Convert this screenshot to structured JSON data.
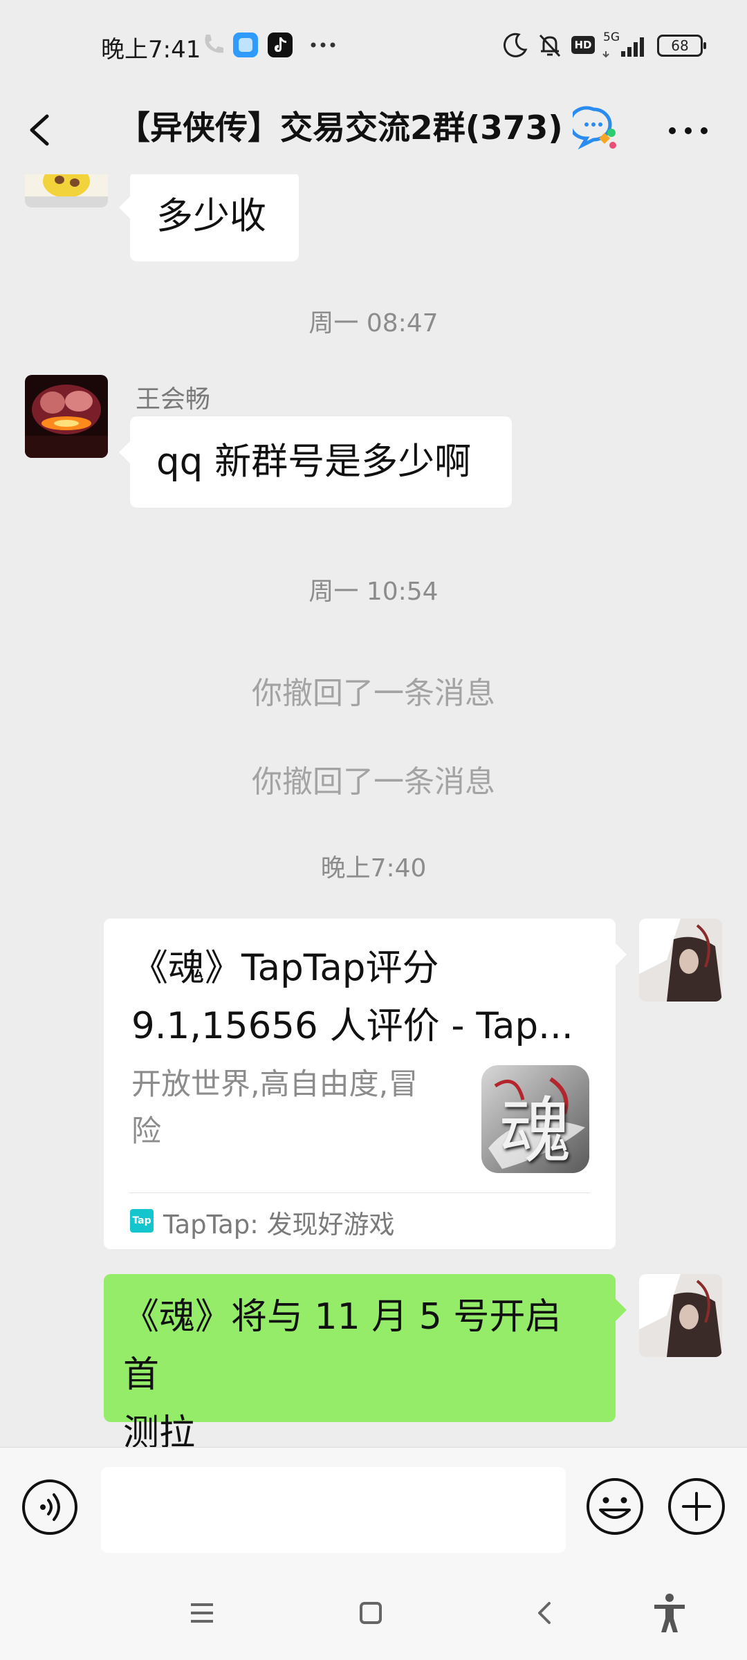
{
  "status_bar": {
    "time": "晚上7:41",
    "network": "5G",
    "hd_badge": "HD",
    "battery": "68",
    "icons": [
      "call-icon",
      "app-icon",
      "tiktok-icon",
      "more-dots-icon",
      "moon-icon",
      "mute-bell-icon",
      "hd-icon",
      "signal-icon",
      "battery-icon"
    ]
  },
  "header": {
    "title": "【异侠传】交易交流2群(373)",
    "icons": [
      "back-icon",
      "group-chat-icon",
      "more-icon"
    ]
  },
  "messages": {
    "m1": {
      "text": "多少收"
    },
    "t1": "周一 08:47",
    "m2": {
      "sender": "王会畅",
      "text": "qq 新群号是多少啊"
    },
    "t2": "周一 10:54",
    "r1": "你撤回了一条消息",
    "r2": "你撤回了一条消息",
    "t3": "晚上7:40",
    "card": {
      "title": "《魂》TapTap评分9.1,15656 人评价 - Tap...",
      "title_line1": "《魂》TapTap评分",
      "title_line2": "9.1,15656 人评价 - Tap...",
      "desc_line1": "开放世界,高自由度,冒",
      "desc_line2": "险",
      "thumb_char": "魂",
      "source_badge": "Tap",
      "source": "TapTap: 发现好游戏"
    },
    "m3": {
      "line1": "《魂》将与 11 月 5 号开启首",
      "line2": "测拉"
    }
  },
  "nav": {
    "icons": [
      "menu-icon",
      "home-icon",
      "back-nav-icon",
      "accessibility-icon"
    ]
  },
  "colors": {
    "background": "#ededed",
    "own_bubble": "#95ec69",
    "bubble": "#ffffff",
    "taptap": "#15c5ce"
  }
}
